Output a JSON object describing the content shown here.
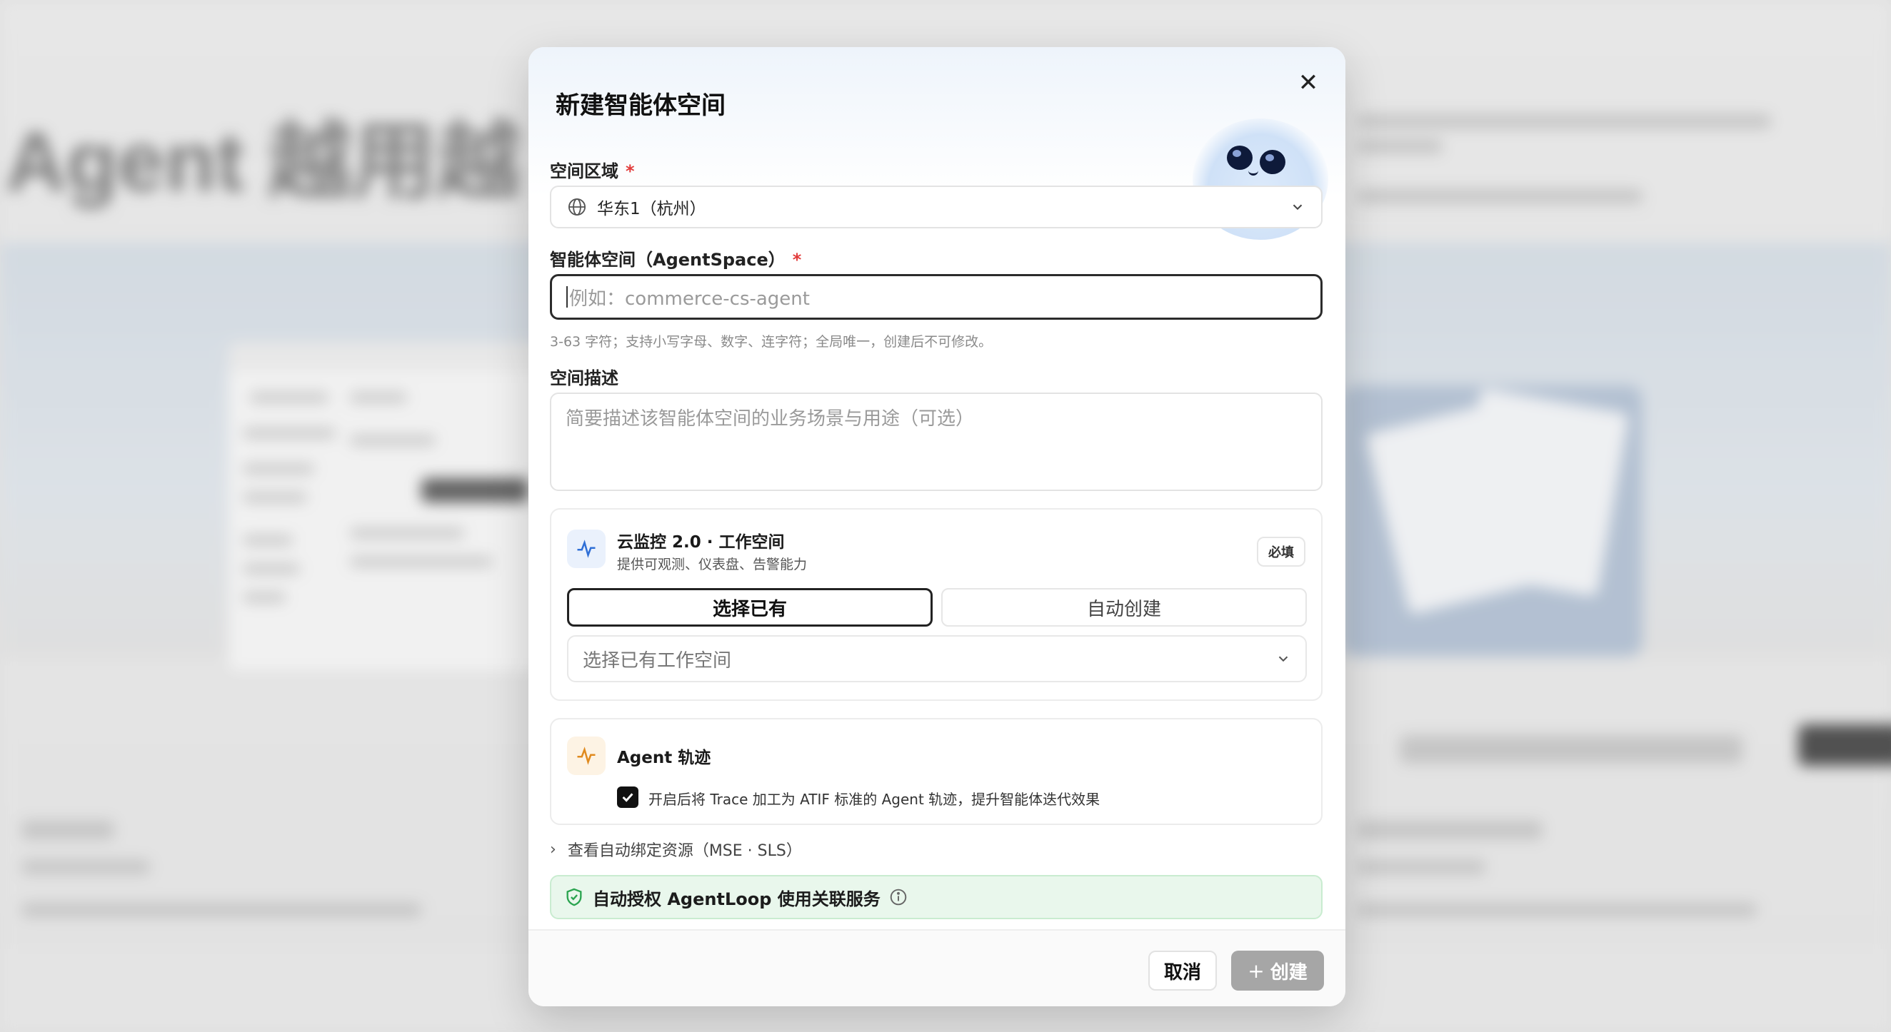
{
  "background": {
    "hero_text": "t Agent 越用越"
  },
  "modal": {
    "title": "新建智能体空间",
    "close_icon": "close-icon",
    "region": {
      "label": "空间区域",
      "required_mark": "*",
      "value": "华东1（杭州）"
    },
    "agentspace": {
      "label": "智能体空间（AgentSpace）",
      "required_mark": "*",
      "placeholder": "例如：commerce-cs-agent",
      "hint": "3-63 字符；支持小写字母、数字、连字符；全局唯一，创建后不可修改。"
    },
    "description": {
      "label": "空间描述",
      "placeholder": "简要描述该智能体空间的业务场景与用途（可选）"
    },
    "monitor_card": {
      "title": "云监控 2.0 · 工作空间",
      "subtitle": "提供可观测、仪表盘、告警能力",
      "badge": "必填",
      "tab_existing": "选择已有",
      "tab_auto": "自动创建",
      "select_placeholder": "选择已有工作空间"
    },
    "trace_card": {
      "title": "Agent 轨迹",
      "checkbox_checked": true,
      "checkbox_label": "开启后将 Trace 加工为 ATIF 标准的 Agent 轨迹，提升智能体迭代效果"
    },
    "bound_resources": "查看自动绑定资源（MSE · SLS）",
    "auth_notice": "自动授权 AgentLoop 使用关联服务",
    "footer": {
      "cancel": "取消",
      "create": "创建"
    }
  }
}
